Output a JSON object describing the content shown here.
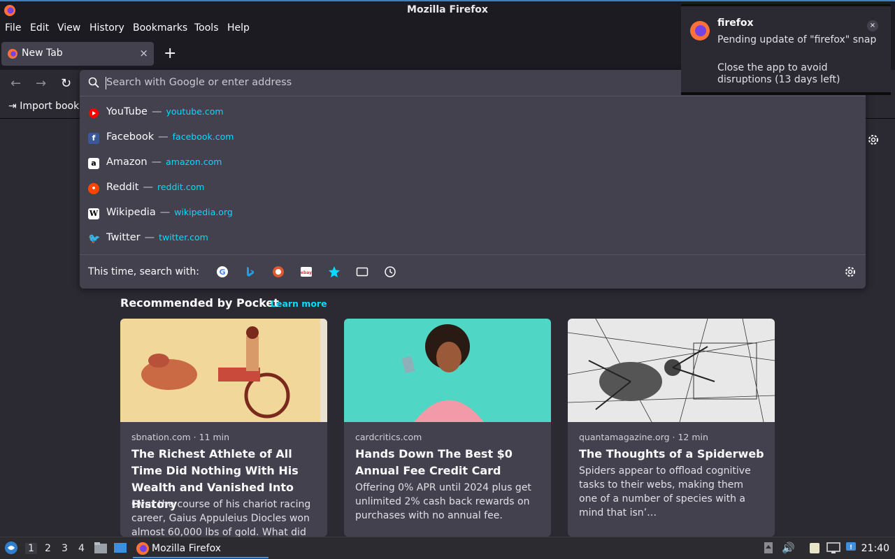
{
  "window": {
    "title": "Mozilla Firefox"
  },
  "menu": {
    "file": "File",
    "edit": "Edit",
    "view": "View",
    "history": "History",
    "bookmarks": "Bookmarks",
    "tools": "Tools",
    "help": "Help"
  },
  "tab": {
    "label": "New Tab",
    "close": "×",
    "new": "+"
  },
  "urlbar": {
    "placeholder": "Search with Google or enter address"
  },
  "bookmarks_bar": {
    "import_label": "Import book"
  },
  "suggestions": [
    {
      "name": "YouTube",
      "url": "youtube.com",
      "icon": "youtube-icon",
      "color": "#ff0000"
    },
    {
      "name": "Facebook",
      "url": "facebook.com",
      "icon": "facebook-icon",
      "color": "#3b5998"
    },
    {
      "name": "Amazon",
      "url": "amazon.com",
      "icon": "amazon-icon",
      "color": "#ffffff"
    },
    {
      "name": "Reddit",
      "url": "reddit.com",
      "icon": "reddit-icon",
      "color": "#ff4500"
    },
    {
      "name": "Wikipedia",
      "url": "wikipedia.org",
      "icon": "wikipedia-icon",
      "color": "#ffffff"
    },
    {
      "name": "Twitter",
      "url": "twitter.com",
      "icon": "twitter-icon",
      "color": "#1da1f2"
    }
  ],
  "separator": "—",
  "search_with": {
    "label": "This time, search with:",
    "engines": [
      "google-icon",
      "bing-icon",
      "duckduckgo-icon",
      "ebay-icon",
      "bookmarks-icon",
      "tabs-icon",
      "history-icon"
    ]
  },
  "notification": {
    "app": "firefox",
    "line1": "Pending update of \"firefox\" snap",
    "line2": "Close the app to avoid disruptions (13 days left)",
    "close": "×"
  },
  "pocket": {
    "heading": "Recommended by Pocket",
    "learn_more": "Learn more",
    "cards": [
      {
        "source": "sbnation.com · 11 min",
        "title": "The Richest Athlete of All Time Did Nothing With His Wealth and Vanished Into History",
        "excerpt": "Over the course of his chariot racing career, Gaius Appuleius Diocles won almost 60,000 lbs of gold. What did he …"
      },
      {
        "source": "cardcritics.com",
        "title": "Hands Down The Best $0 Annual Fee Credit Card",
        "excerpt": "Offering 0% APR until 2024 plus get unlimited 2% cash back rewards on purchases with no annual fee."
      },
      {
        "source": "quantamagazine.org · 12 min",
        "title": "The Thoughts of a Spiderweb",
        "excerpt": "Spiders appear to offload cognitive tasks to their webs, making them one of a number of species with a mind that isn’…"
      }
    ]
  },
  "taskbar": {
    "workspaces": [
      "1",
      "2",
      "3",
      "4"
    ],
    "app_label": "Mozilla Firefox",
    "clock": "21:40"
  },
  "colors": {
    "accent": "#00ddff",
    "panel": "#42414d",
    "bg": "#2b2a33"
  }
}
